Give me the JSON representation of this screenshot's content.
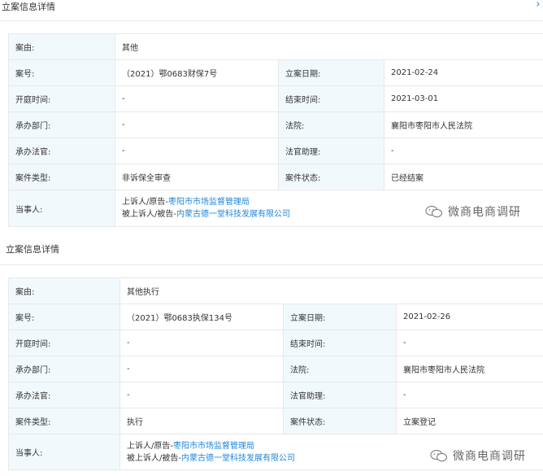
{
  "sections": [
    {
      "title": "立案信息详情",
      "fields": {
        "cause": {
          "label": "案由:",
          "value": "其他"
        },
        "case_no": {
          "label": "案号:",
          "value": "（2021）鄂0683财保7号"
        },
        "filing_date": {
          "label": "立案日期:",
          "value": "2021-02-24"
        },
        "hearing_time": {
          "label": "开庭时间:",
          "value": "-"
        },
        "end_time": {
          "label": "结束时间:",
          "value": "2021-03-01"
        },
        "department": {
          "label": "承办部门:",
          "value": "-"
        },
        "court": {
          "label": "法院:",
          "value": "襄阳市枣阳市人民法院"
        },
        "judge": {
          "label": "承办法官:",
          "value": "-"
        },
        "assistant": {
          "label": "法官助理:",
          "value": "-"
        },
        "case_type": {
          "label": "案件类型:",
          "value": "非诉保全审查"
        },
        "case_status": {
          "label": "案件状态:",
          "value": "已经结案"
        },
        "parties": {
          "label": "当事人:",
          "plaintiff_role": "上诉人/原告-",
          "plaintiff": "枣阳市市场监督管理局",
          "defendant_role": "被上诉人/被告-",
          "defendant": "内蒙古德一堂科技发展有限公司"
        }
      }
    },
    {
      "title": "立案信息详情",
      "fields": {
        "cause": {
          "label": "案由:",
          "value": "其他执行"
        },
        "case_no": {
          "label": "案号:",
          "value": "（2021）鄂0683执保134号"
        },
        "filing_date": {
          "label": "立案日期:",
          "value": "2021-02-26"
        },
        "hearing_time": {
          "label": "开庭时间:",
          "value": "-"
        },
        "end_time": {
          "label": "结束时间:",
          "value": "-"
        },
        "department": {
          "label": "承办部门:",
          "value": "-"
        },
        "court": {
          "label": "法院:",
          "value": "襄阳市枣阳市人民法院"
        },
        "judge": {
          "label": "承办法官:",
          "value": "-"
        },
        "assistant": {
          "label": "法官助理:",
          "value": "-"
        },
        "case_type": {
          "label": "案件类型:",
          "value": "执行"
        },
        "case_status": {
          "label": "案件状态:",
          "value": "立案登记"
        },
        "parties": {
          "label": "当事人:",
          "plaintiff_role": "上诉人/原告-",
          "plaintiff": "枣阳市市场监督管理局",
          "defendant_role": "被上诉人/被告-",
          "defendant": "内蒙古德一堂科技发展有限公司"
        }
      }
    }
  ],
  "close_icon": "close-icon",
  "watermark": {
    "text": "微商电商调研",
    "icon": "wechat-icon"
  },
  "colors": {
    "label_bg": "#f2f9fc",
    "link": "#1e86d9",
    "border": "#e8e8e8",
    "text": "#333333"
  }
}
